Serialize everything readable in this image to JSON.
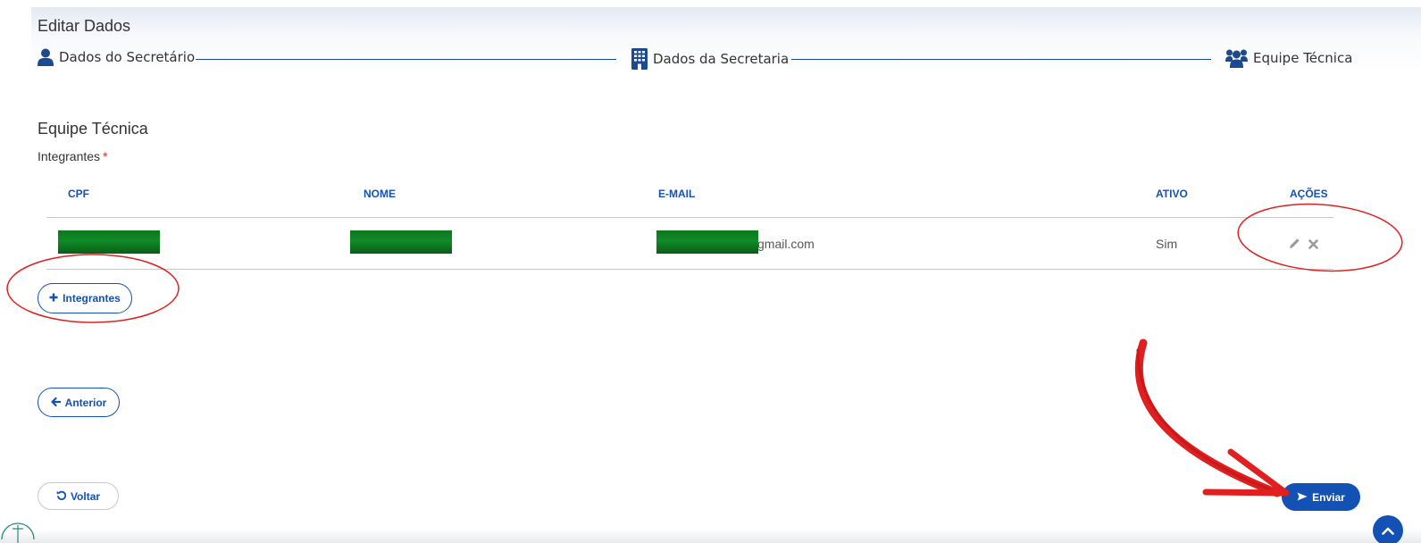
{
  "page": {
    "title": "Editar Dados"
  },
  "stepper": {
    "steps": [
      {
        "label": "Dados do Secretário",
        "icon": "user-icon"
      },
      {
        "label": "Dados da Secretaria",
        "icon": "building-icon"
      },
      {
        "label": "Equipe Técnica",
        "icon": "users-icon"
      }
    ]
  },
  "section": {
    "title": "Equipe Técnica",
    "field_label": "Integrantes",
    "required_mark": "*"
  },
  "table": {
    "columns": [
      "CPF",
      "NOME",
      "E-MAIL",
      "ATIVO",
      "AÇÕES"
    ],
    "rows": [
      {
        "email_suffix": "gmail.com",
        "ativo": "Sim",
        "actions": [
          "pencil-icon",
          "close-icon"
        ]
      }
    ]
  },
  "buttons": {
    "add_integrantes": "Integrantes",
    "anterior": "Anterior",
    "voltar": "Voltar",
    "enviar": "Enviar"
  },
  "colors": {
    "primary": "#1351b4",
    "annotation_red": "#e02020",
    "redaction_green": "#118a27"
  }
}
